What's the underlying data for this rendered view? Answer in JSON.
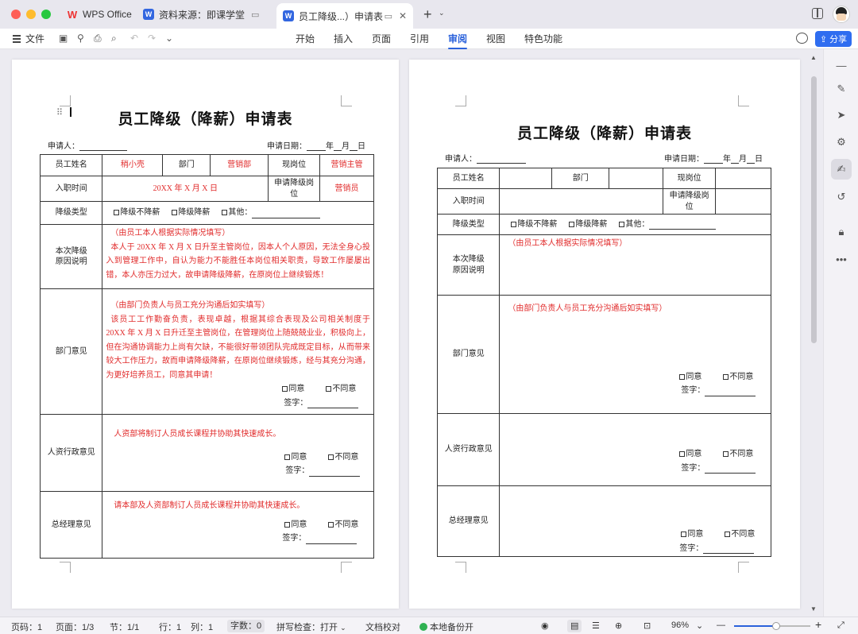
{
  "tabs": {
    "wps": "WPS Office",
    "resource": "资料来源：即课学堂",
    "current": "员工降级...）申请表"
  },
  "ribbon": {
    "file": "文件",
    "tabs": [
      "开始",
      "插入",
      "页面",
      "引用",
      "审阅",
      "视图",
      "特色功能"
    ],
    "active_tab": "审阅",
    "share": "分享"
  },
  "doc": {
    "title": "员工降级（降薪）申请表",
    "applicant": "申请人：",
    "apply_date": "申请日期：",
    "date_y": "年",
    "date_m": "月",
    "date_d": "日",
    "labels": {
      "name": "员工姓名",
      "dept": "部门",
      "position": "现岗位",
      "hire_date": "入职时间",
      "target_post": "申请降级岗位",
      "type": "降级类型",
      "reason_1": "本次降级",
      "reason_2": "原因说明",
      "dept_opinion": "部门意见",
      "hr_opinion": "人资行政意见",
      "gm_opinion": "总经理意见"
    },
    "opt_no_salary": "降级不降薪",
    "opt_salary": "降级降薪",
    "opt_other": "其他：",
    "agree": "同意",
    "disagree": "不同意",
    "sign": "签字："
  },
  "filled": {
    "name": "稍小壳",
    "dept": "营销部",
    "position": "营销主管",
    "hire_date": "20XX 年 X 月 X 日",
    "target_post": "营销员",
    "reason_hint": "（由员工本人根据实际情况填写）",
    "reason_text": "本人于 20XX 年 X 月 X 日升至主管岗位，因本人个人原因，无法全身心投入到管理工作中，自认为能力不能胜任本岗位相关职责，导致工作屡屡出错，本人亦压力过大，故申请降级降薪，在原岗位上继续锻炼！",
    "dept_hint": "（由部门负责人与员工充分沟通后如实填写）",
    "dept_text": "该员工工作勤奋负责，表现卓越，根据其综合表现及公司相关制度于 20XX 年 X 月 X 日升迁至主管岗位，在管理岗位上随兢兢业业，积极向上，但在沟通协调能力上尚有欠缺，不能很好带领团队完成既定目标，从而带来较大工作压力，故而申请降级降薪，在原岗位继续锻炼，经与其充分沟通，为更好培养员工，同意其申请！",
    "hr_text": "人资部将制订人员成长课程并协助其快速成长。",
    "gm_text": "请本部及人资部制订人员成长课程并协助其快速成长。"
  },
  "status": {
    "page_no": "页码：1",
    "pages": "页面：1/3",
    "section": "节：1/1",
    "row": "行：1",
    "col": "列：1",
    "words": "字数：0",
    "spell": "拼写检查：打开",
    "proof": "文档校对",
    "backup": "本地备份开",
    "zoom": "96%",
    "zoom_fraction": 0.55
  }
}
